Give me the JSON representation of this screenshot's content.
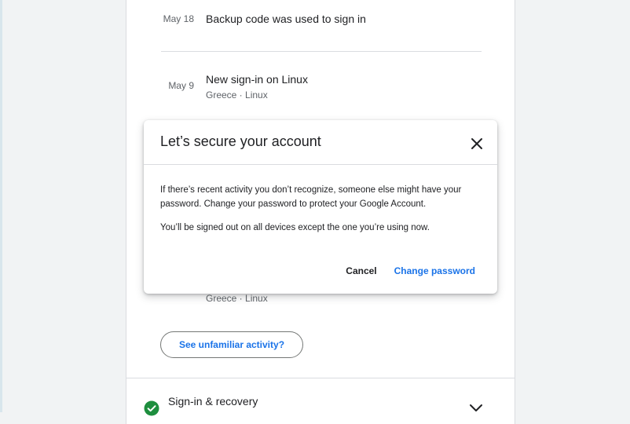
{
  "activity": {
    "events": [
      {
        "date": "May 18",
        "title": "Backup code was used to sign in",
        "sub": ""
      },
      {
        "date": "May 9",
        "title": "New sign-in on Linux",
        "sub": "Greece · Linux"
      },
      {
        "date": "",
        "title": "",
        "sub": "Greece · Linux"
      }
    ],
    "unfamiliar_button": "See unfamiliar activity?"
  },
  "section": {
    "title": "Sign-in & recovery",
    "status_icon": "check-circle-icon",
    "status_color": "#1e8e3e"
  },
  "dialog": {
    "title": "Let’s secure your account",
    "body_1": "If there’s recent activity you don’t recognize, someone else might have your password. Change your password to protect your Google Account.",
    "body_2": "You’ll be signed out on all devices except the one you’re using now.",
    "cancel_label": "Cancel",
    "change_label": "Change password",
    "accent_color": "#1a73e8"
  }
}
